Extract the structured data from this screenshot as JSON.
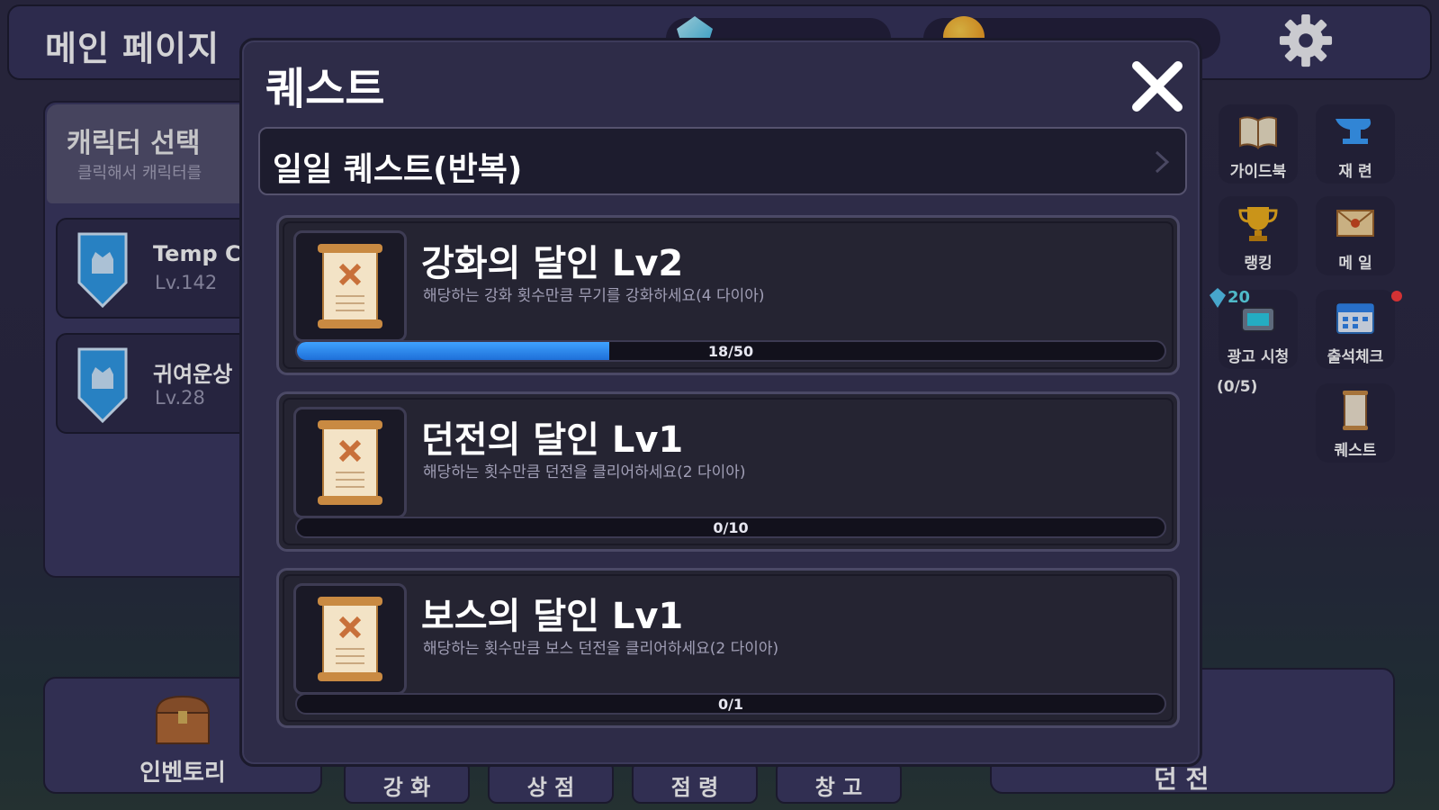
{
  "header": {
    "page_title": "메인 페이지",
    "gems_value": "",
    "gold_value": ""
  },
  "left_panel": {
    "title": "캐릭터 선택",
    "subtitle": "클릭해서 캐릭터를",
    "characters": [
      {
        "name": "Temp C",
        "level": "Lv.142"
      },
      {
        "name": "귀여운상",
        "level": "Lv.28"
      }
    ]
  },
  "side_menu": {
    "guidebook": "가이드북",
    "reforge": "재 련",
    "ranking": "랭킹",
    "mail": "메 일",
    "ad_watch": "광고 시청",
    "ad_gem_reward": "20",
    "ad_count": "(0/5)",
    "attendance": "출석체크",
    "quest": "퀘스트"
  },
  "bottom_nav": {
    "inventory": "인벤토리",
    "enhance": "강 화",
    "shop": "상 점",
    "occupy": "점 령",
    "storage": "창 고",
    "dungeon": "던 전"
  },
  "quest_modal": {
    "title": "퀘스트",
    "section_label": "일일 퀘스트(반복)",
    "quests": [
      {
        "name": "강화의 달인 Lv2",
        "description": "해당하는 강화 횟수만큼 무기를 강화하세요(4 다이아)",
        "progress_text": "18/50",
        "progress": 0.36
      },
      {
        "name": "던전의 달인 Lv1",
        "description": "해당하는 횟수만큼 던전을 클리어하세요(2 다이아)",
        "progress_text": "0/10",
        "progress": 0
      },
      {
        "name": "보스의 달인 Lv1",
        "description": "해당하는 횟수만큼 보스 던전을 클리어하세요(2 다이아)",
        "progress_text": "0/1",
        "progress": 0
      }
    ]
  },
  "colors": {
    "accent_blue": "#2f86f0",
    "panel": "#3a3760",
    "modal_bg": "#2e2c48"
  }
}
